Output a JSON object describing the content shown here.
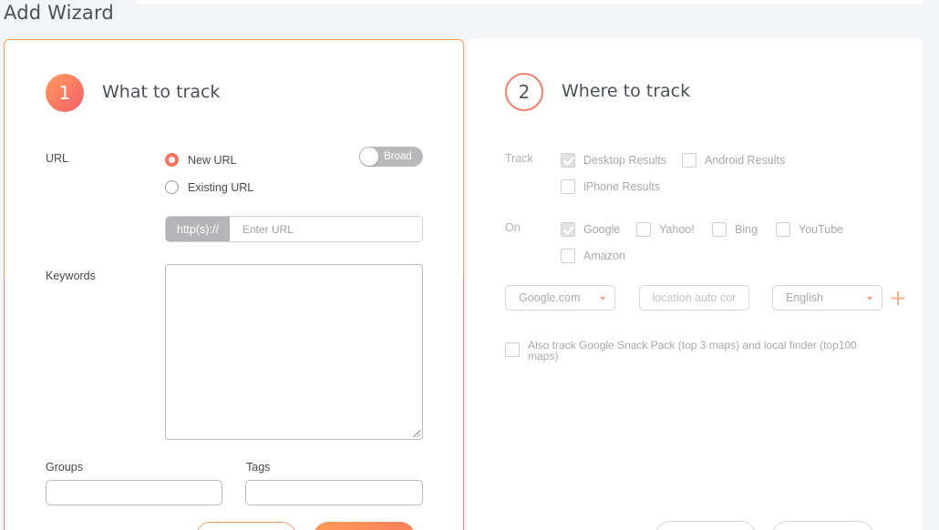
{
  "page": {
    "title": "Add Wizard"
  },
  "step1": {
    "number": "1",
    "title": "What to track",
    "url_label": "URL",
    "url_options": [
      {
        "label": "New URL",
        "selected": true
      },
      {
        "label": "Existing URL",
        "selected": false
      }
    ],
    "broad_toggle": {
      "label": "Broad",
      "on": false
    },
    "url_prefix": "http(s)://",
    "url_placeholder": "Enter URL",
    "keywords_label": "Keywords",
    "groups_label": "Groups",
    "tags_label": "Tags"
  },
  "step2": {
    "number": "2",
    "title": "Where to track",
    "track_label": "Track",
    "track_options": [
      {
        "label": "Desktop Results",
        "checked": true
      },
      {
        "label": "Android Results",
        "checked": false
      },
      {
        "label": "iPhone Results",
        "checked": false
      }
    ],
    "on_label": "On",
    "on_options": [
      {
        "label": "Google",
        "checked": true
      },
      {
        "label": "Yahoo!",
        "checked": false
      },
      {
        "label": "Bing",
        "checked": false
      },
      {
        "label": "YouTube",
        "checked": false
      },
      {
        "label": "Amazon",
        "checked": false
      }
    ],
    "engine_select": "Google.com",
    "location_placeholder": "location auto cor",
    "language_select": "English",
    "snack_pack_label": "Also track Google Snack Pack (top 3 maps) and local finder (top100 maps)"
  },
  "colors": {
    "accent": "#f5735c",
    "accent_light": "#ff9a5a",
    "panel_border": "#f2a35c"
  }
}
